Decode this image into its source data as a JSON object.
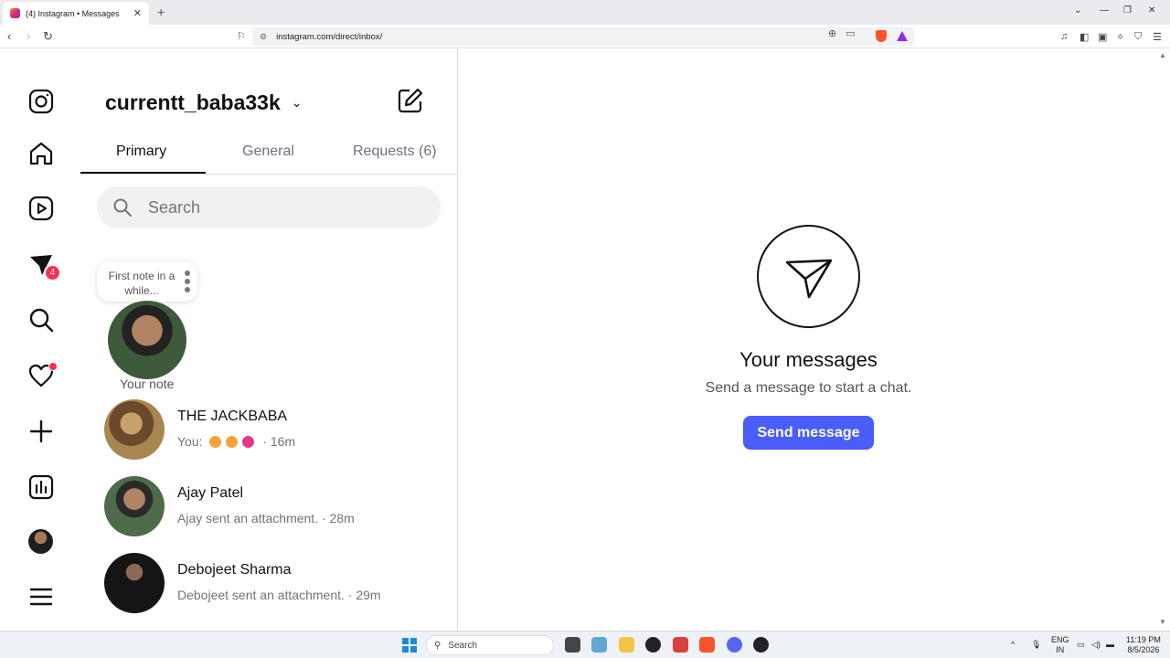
{
  "browser": {
    "tab_title": "(4) Instagram • Messages",
    "new_tab": "+",
    "url": "instagram.com/direct/inbox/"
  },
  "sidebar": {
    "notifications_badge": "4"
  },
  "inbox": {
    "username": "currentt_baba33k",
    "tabs": [
      {
        "label": "Primary"
      },
      {
        "label": "General"
      },
      {
        "label": "Requests (6)"
      }
    ],
    "search_placeholder": "Search",
    "note_text": "First note in a while...",
    "your_note_label": "Your note",
    "conversations": [
      {
        "name": "THE JACKBABA",
        "preview": "You:",
        "time": "· 16m",
        "emoji_colors": [
          "#f7a23c",
          "#f7a23c",
          "#e8378a"
        ]
      },
      {
        "name": "Ajay Patel",
        "preview": "Ajay sent an attachment. · 28m"
      },
      {
        "name": "Debojeet Sharma",
        "preview": "Debojeet sent an attachment. · 29m"
      }
    ]
  },
  "empty_state": {
    "title": "Your messages",
    "subtitle": "Send a message to start a chat.",
    "button": "Send message"
  },
  "taskbar": {
    "search": "Search",
    "lang_top": "ENG",
    "lang_bottom": "IN",
    "time": "11:19 PM",
    "date": "8/5/2026"
  },
  "colors": {
    "accent": "#4a5df9",
    "badge": "#ff2e4c"
  }
}
